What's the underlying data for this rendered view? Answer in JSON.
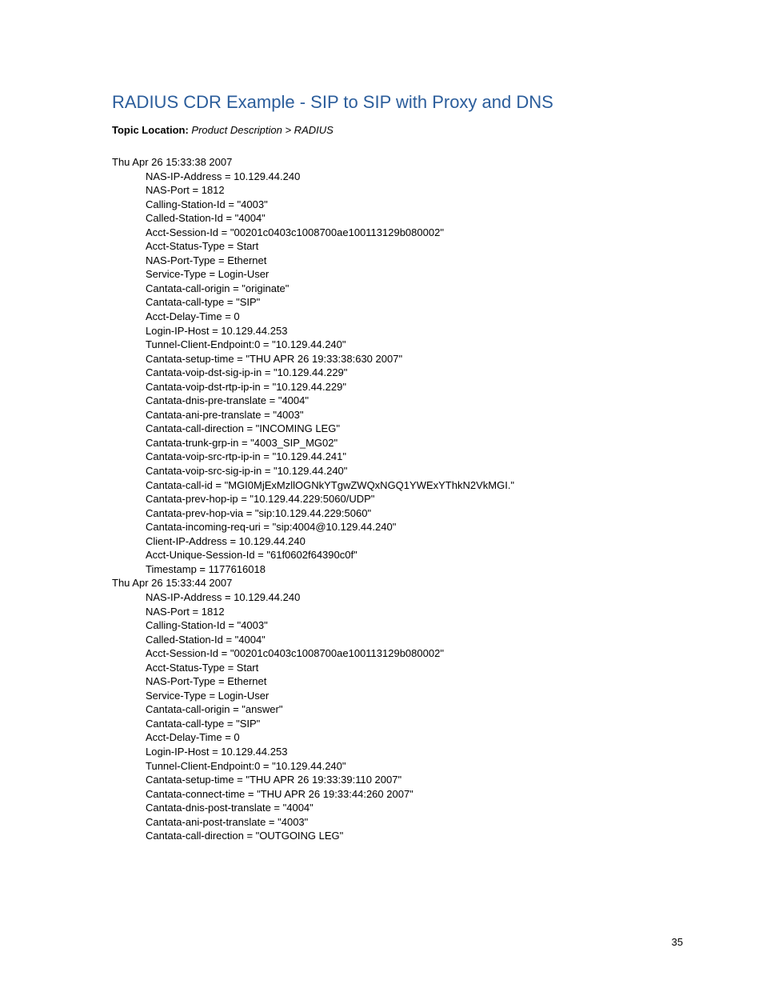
{
  "title": "RADIUS CDR Example - SIP to SIP with Proxy and DNS",
  "topic_label": "Topic Location: ",
  "topic_path": "Product Description > RADIUS",
  "records": [
    {
      "ts": "Thu Apr 26 15:33:38 2007",
      "attrs": [
        "NAS-IP-Address = 10.129.44.240",
        "NAS-Port = 1812",
        "Calling-Station-Id = \"4003\"",
        "Called-Station-Id = \"4004\"",
        "Acct-Session-Id = \"00201c0403c1008700ae100113129b080002\"",
        "Acct-Status-Type = Start",
        "NAS-Port-Type = Ethernet",
        "Service-Type = Login-User",
        "Cantata-call-origin = \"originate\"",
        "Cantata-call-type = \"SIP\"",
        "Acct-Delay-Time = 0",
        "Login-IP-Host = 10.129.44.253",
        "Tunnel-Client-Endpoint:0 = \"10.129.44.240\"",
        "Cantata-setup-time = \"THU APR 26 19:33:38:630 2007\"",
        "Cantata-voip-dst-sig-ip-in = \"10.129.44.229\"",
        "Cantata-voip-dst-rtp-ip-in = \"10.129.44.229\"",
        "Cantata-dnis-pre-translate = \"4004\"",
        "Cantata-ani-pre-translate = \"4003\"",
        "Cantata-call-direction = \"INCOMING LEG\"",
        "Cantata-trunk-grp-in = \"4003_SIP_MG02\"",
        "Cantata-voip-src-rtp-ip-in = \"10.129.44.241\"",
        "Cantata-voip-src-sig-ip-in = \"10.129.44.240\"",
        "Cantata-call-id = \"MGI0MjExMzllOGNkYTgwZWQxNGQ1YWExYThkN2VkMGI.\"",
        "Cantata-prev-hop-ip = \"10.129.44.229:5060/UDP\"",
        "Cantata-prev-hop-via = \"sip:10.129.44.229:5060\"",
        "Cantata-incoming-req-uri = \"sip:4004@10.129.44.240\"",
        "Client-IP-Address = 10.129.44.240",
        "Acct-Unique-Session-Id = \"61f0602f64390c0f\"",
        "Timestamp = 1177616018"
      ]
    },
    {
      "ts": "Thu Apr 26 15:33:44 2007",
      "attrs": [
        "NAS-IP-Address = 10.129.44.240",
        "NAS-Port = 1812",
        "Calling-Station-Id = \"4003\"",
        "Called-Station-Id = \"4004\"",
        "Acct-Session-Id = \"00201c0403c1008700ae100113129b080002\"",
        "Acct-Status-Type = Start",
        "NAS-Port-Type = Ethernet",
        "Service-Type = Login-User",
        "Cantata-call-origin = \"answer\"",
        "Cantata-call-type = \"SIP\"",
        "Acct-Delay-Time = 0",
        "Login-IP-Host = 10.129.44.253",
        "Tunnel-Client-Endpoint:0 = \"10.129.44.240\"",
        "Cantata-setup-time = \"THU APR 26 19:33:39:110 2007\"",
        "Cantata-connect-time = \"THU APR 26 19:33:44:260 2007\"",
        "Cantata-dnis-post-translate = \"4004\"",
        "Cantata-ani-post-translate = \"4003\"",
        "Cantata-call-direction = \"OUTGOING LEG\""
      ]
    }
  ],
  "page_number": "35"
}
